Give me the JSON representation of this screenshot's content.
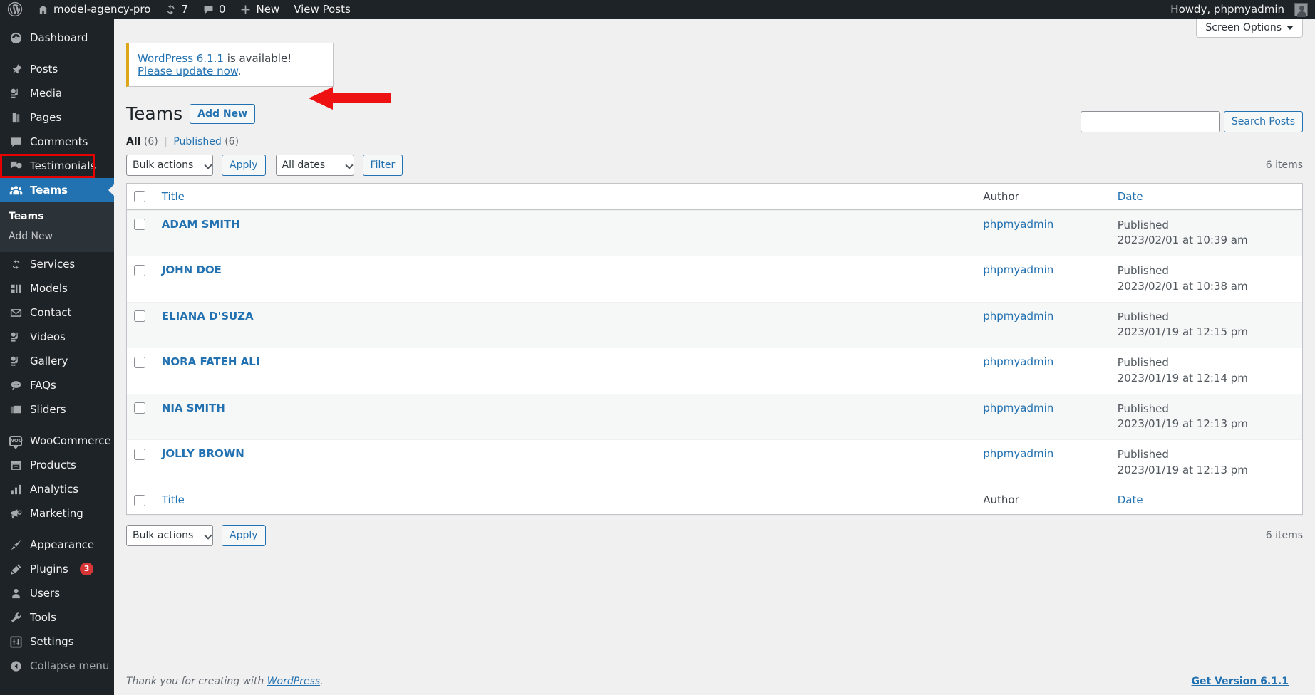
{
  "adminbar": {
    "logo_icon": "wordpress-logo-icon",
    "site_name": "model-agency-pro",
    "home_icon": "home-icon",
    "updates_icon": "updates-icon",
    "updates_count": "7",
    "comments_icon": "comment-bubble-icon",
    "comments_count": "0",
    "new_icon": "plus-icon",
    "new_label": "New",
    "view_posts_label": "View Posts",
    "howdy": "Howdy, phpmyadmin",
    "avatar_icon": "avatar-icon"
  },
  "sidebar": {
    "items": [
      {
        "label": "Dashboard",
        "icon": "dashboard-icon",
        "current": false
      },
      {
        "label": "Posts",
        "icon": "pin-icon",
        "current": false
      },
      {
        "label": "Media",
        "icon": "media-icon",
        "current": false
      },
      {
        "label": "Pages",
        "icon": "pages-icon",
        "current": false
      },
      {
        "label": "Comments",
        "icon": "comment-bubble-icon",
        "current": false
      },
      {
        "label": "Testimonials",
        "icon": "testimonials-icon",
        "current": false
      },
      {
        "label": "Teams",
        "icon": "teams-icon",
        "current": true
      },
      {
        "label": "Services",
        "icon": "services-icon",
        "current": false
      },
      {
        "label": "Models",
        "icon": "models-icon",
        "current": false
      },
      {
        "label": "Contact",
        "icon": "envelope-icon",
        "current": false
      },
      {
        "label": "Videos",
        "icon": "media-icon",
        "current": false
      },
      {
        "label": "Gallery",
        "icon": "media-icon",
        "current": false
      },
      {
        "label": "FAQs",
        "icon": "faq-bubble-icon",
        "current": false
      },
      {
        "label": "Sliders",
        "icon": "sliders-icon",
        "current": false
      },
      {
        "label": "WooCommerce",
        "icon": "woocommerce-icon",
        "current": false
      },
      {
        "label": "Products",
        "icon": "products-box-icon",
        "current": false
      },
      {
        "label": "Analytics",
        "icon": "analytics-bars-icon",
        "current": false
      },
      {
        "label": "Marketing",
        "icon": "megaphone-icon",
        "current": false
      },
      {
        "label": "Appearance",
        "icon": "paintbrush-icon",
        "current": false
      },
      {
        "label": "Plugins",
        "icon": "plugin-icon",
        "current": false,
        "badge": "3"
      },
      {
        "label": "Users",
        "icon": "user-icon",
        "current": false
      },
      {
        "label": "Tools",
        "icon": "wrench-icon",
        "current": false
      },
      {
        "label": "Settings",
        "icon": "settings-sliders-icon",
        "current": false
      }
    ],
    "submenu": [
      {
        "label": "Teams",
        "current": true
      },
      {
        "label": "Add New",
        "current": false
      }
    ],
    "collapse_label": "Collapse menu",
    "collapse_icon": "collapse-arrow-icon"
  },
  "screen_options": {
    "label": "Screen Options",
    "chevron_icon": "chevron-down-icon"
  },
  "notice": {
    "link_version": "WordPress 6.1.1",
    "middle_text": " is available! ",
    "link_update": "Please update now",
    "end_text": "."
  },
  "page": {
    "title": "Teams",
    "add_new_label": "Add New",
    "annotation_arrow": "red-arrow-annotation",
    "annotation_box": "red-highlight-box"
  },
  "views": {
    "all_label": "All",
    "all_count": "(6)",
    "separator": "|",
    "published_label": "Published",
    "published_count": "(6)"
  },
  "search": {
    "value": "",
    "placeholder": "",
    "button_label": "Search Posts"
  },
  "tablenav_top": {
    "bulk_actions": "Bulk actions",
    "apply_label": "Apply",
    "all_dates": "All dates",
    "filter_label": "Filter",
    "displaying_num": "6 items"
  },
  "tablenav_bottom": {
    "bulk_actions": "Bulk actions",
    "apply_label": "Apply",
    "displaying_num": "6 items"
  },
  "table": {
    "columns": [
      "Title",
      "Author",
      "Date"
    ],
    "rows": [
      {
        "title": "ADAM SMITH",
        "author": "phpmyadmin",
        "status": "Published",
        "date": "2023/02/01 at 10:39 am"
      },
      {
        "title": "JOHN DOE",
        "author": "phpmyadmin",
        "status": "Published",
        "date": "2023/02/01 at 10:38 am"
      },
      {
        "title": "ELIANA D'SUZA",
        "author": "phpmyadmin",
        "status": "Published",
        "date": "2023/01/19 at 12:15 pm"
      },
      {
        "title": "NORA FATEH ALI",
        "author": "phpmyadmin",
        "status": "Published",
        "date": "2023/01/19 at 12:14 pm"
      },
      {
        "title": "NIA SMITH",
        "author": "phpmyadmin",
        "status": "Published",
        "date": "2023/01/19 at 12:13 pm"
      },
      {
        "title": "JOLLY BROWN",
        "author": "phpmyadmin",
        "status": "Published",
        "date": "2023/01/19 at 12:13 pm"
      }
    ]
  },
  "footer": {
    "thanks_prefix": "Thank you for creating with ",
    "thanks_link": "WordPress",
    "thanks_suffix": ".",
    "version_link": "Get Version 6.1.1"
  },
  "colors": {
    "admin_dark": "#1d2327",
    "submenu_bg": "#2c3338",
    "accent_blue": "#2271b1",
    "annotation_red": "#e60000",
    "notice_yellow": "#dba617",
    "badge_red": "#d63638",
    "page_bg": "#f0f0f1"
  }
}
